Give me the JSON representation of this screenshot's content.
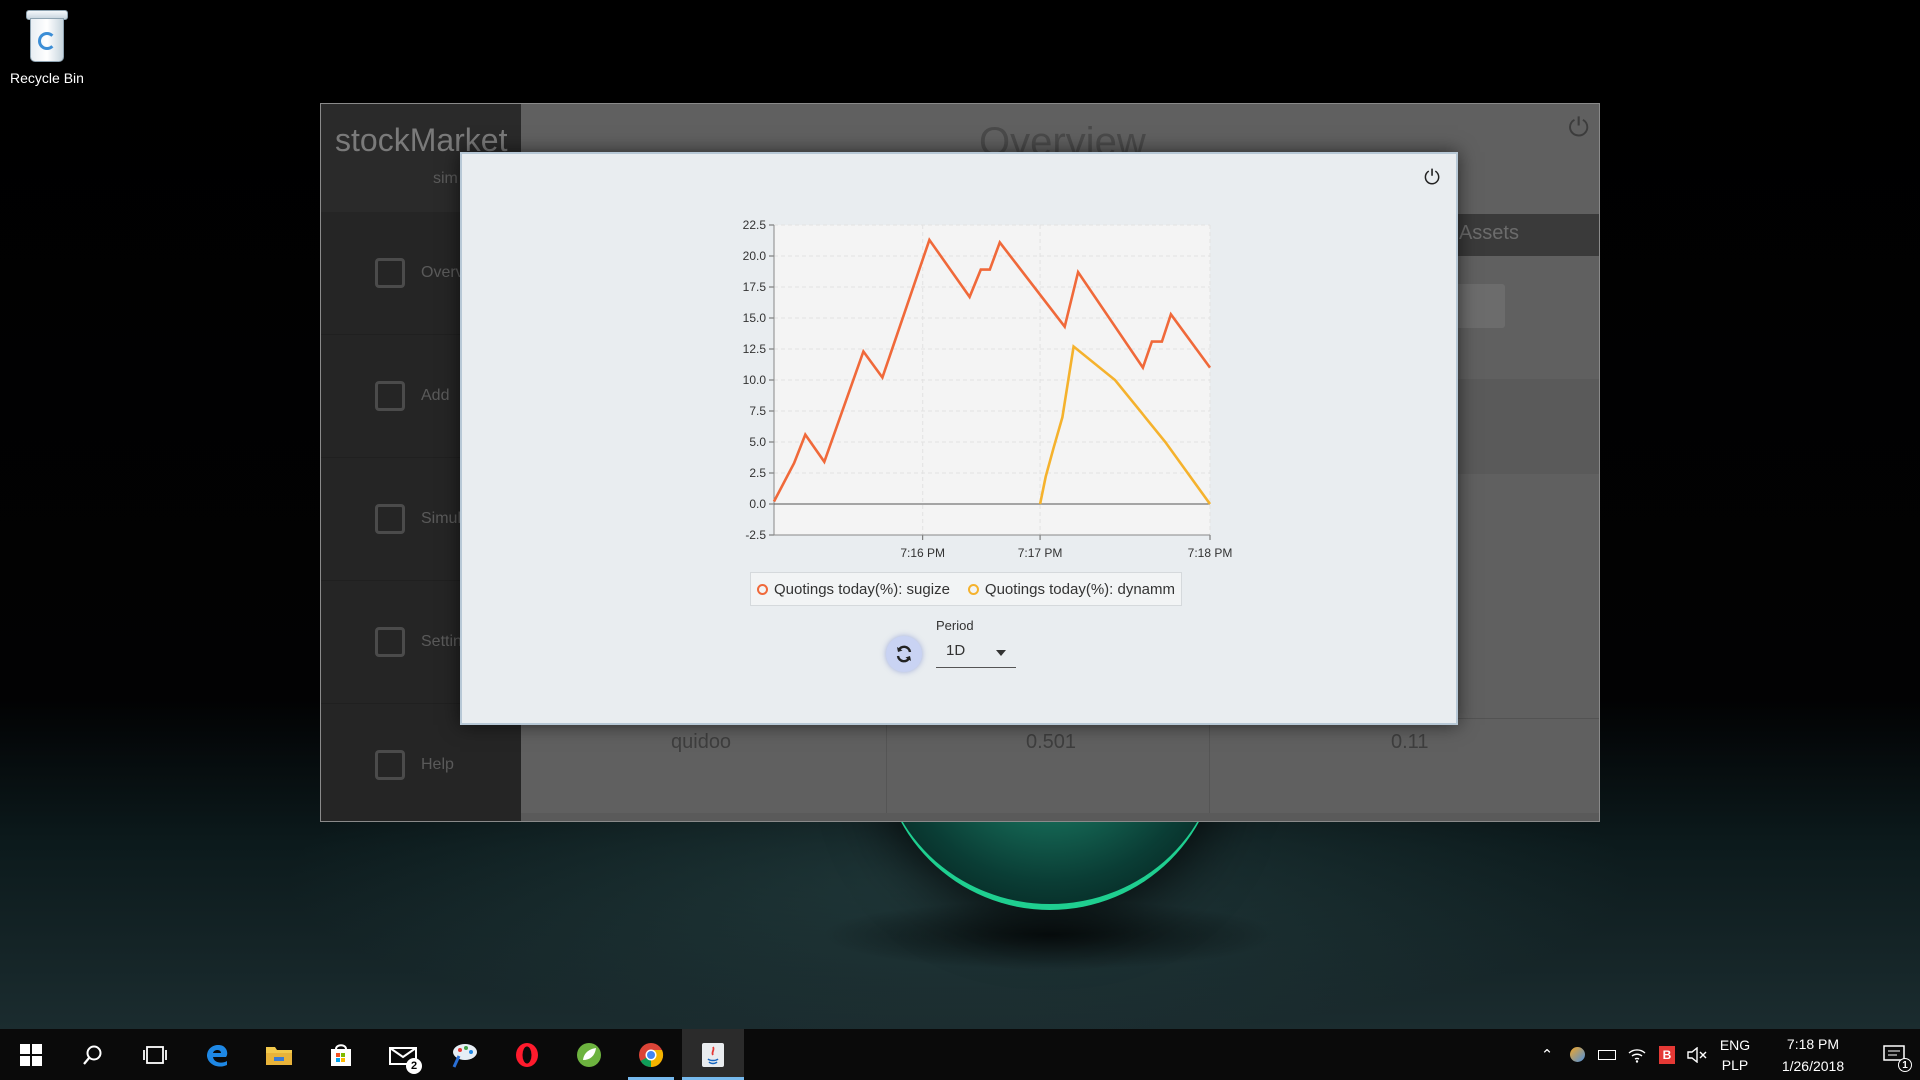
{
  "desktop": {
    "recycle_bin_label": "Recycle Bin"
  },
  "app_window": {
    "logo": "stockMarket",
    "logo_sub": "sim",
    "page_title": "Overview",
    "nav": [
      {
        "label": "Overview",
        "icon": "chart-icon"
      },
      {
        "label": "Add",
        "icon": "plus-icon"
      },
      {
        "label": "Simulate",
        "icon": "refresh-icon"
      },
      {
        "label": "Settings",
        "icon": "gear-icon"
      },
      {
        "label": "Help",
        "icon": "help-icon"
      }
    ],
    "tab_label": "Assets",
    "visible_row": [
      "quidoo",
      "0.501",
      "0.11"
    ]
  },
  "dialog": {
    "period_label": "Period",
    "period_value": "1D"
  },
  "chart_data": {
    "type": "line",
    "x_ticks": [
      "7:16 PM",
      "7:17 PM",
      "7:18 PM"
    ],
    "x_tick_positions_min": [
      1.33,
      2.38,
      3.9
    ],
    "y_ticks": [
      -2.5,
      0.0,
      2.5,
      5.0,
      7.5,
      10.0,
      12.5,
      15.0,
      17.5,
      20.0,
      22.5
    ],
    "y_ticks_text": [
      "-2.5",
      "0.0",
      "2.5",
      "5.0",
      "7.5",
      "10.0",
      "12.5",
      "15.0",
      "17.5",
      "20.0",
      "22.5"
    ],
    "ylim": [
      -2.5,
      22.5
    ],
    "xlim_min": [
      0,
      3.9
    ],
    "grid": true,
    "legend_position": "bottom",
    "series": [
      {
        "name": "Quotings today(%): sugize",
        "color": "#f0693a",
        "x": [
          0,
          0.18,
          0.28,
          0.45,
          0.8,
          0.97,
          1.39,
          1.75,
          1.85,
          1.93,
          2.02,
          2.6,
          2.72,
          3.3,
          3.38,
          3.47,
          3.55,
          3.9
        ],
        "y": [
          0.2,
          3.3,
          5.6,
          3.4,
          12.3,
          10.2,
          21.3,
          16.7,
          18.9,
          18.9,
          21.1,
          14.3,
          18.7,
          11.0,
          13.1,
          13.1,
          15.3,
          11.0
        ]
      },
      {
        "name": "Quotings today(%): dynamm",
        "color": "#f5b22d",
        "x": [
          2.38,
          2.43,
          2.5,
          2.58,
          2.68,
          3.05,
          3.5,
          3.9
        ],
        "y": [
          0.0,
          2.2,
          4.5,
          7.0,
          12.7,
          10.0,
          5.0,
          0.0
        ]
      }
    ]
  },
  "taskbar": {
    "apps": [
      {
        "name": "start-button",
        "icon": "windows-icon"
      },
      {
        "name": "search-button",
        "icon": "search-icon"
      },
      {
        "name": "task-view-button",
        "icon": "task-view-icon"
      },
      {
        "name": "edge-button",
        "icon": "edge-icon"
      },
      {
        "name": "file-explorer-button",
        "icon": "folder-icon"
      },
      {
        "name": "store-button",
        "icon": "store-icon"
      },
      {
        "name": "mail-button",
        "icon": "mail-icon",
        "badge": "2"
      },
      {
        "name": "paint-button",
        "icon": "paint-icon"
      },
      {
        "name": "opera-button",
        "icon": "opera-icon"
      },
      {
        "name": "spring-button",
        "icon": "spring-icon"
      },
      {
        "name": "chrome-button",
        "icon": "chrome-icon"
      },
      {
        "name": "java-button",
        "icon": "java-icon"
      }
    ],
    "lang_top": "ENG",
    "lang_bottom": "PLP",
    "time": "7:18 PM",
    "date": "1/26/2018",
    "notification_count": "1",
    "tray_b_label": "B"
  },
  "colors": {
    "accent": "#76b9ed",
    "series_sugize": "#f0693a",
    "series_dynamm": "#f5b22d"
  }
}
